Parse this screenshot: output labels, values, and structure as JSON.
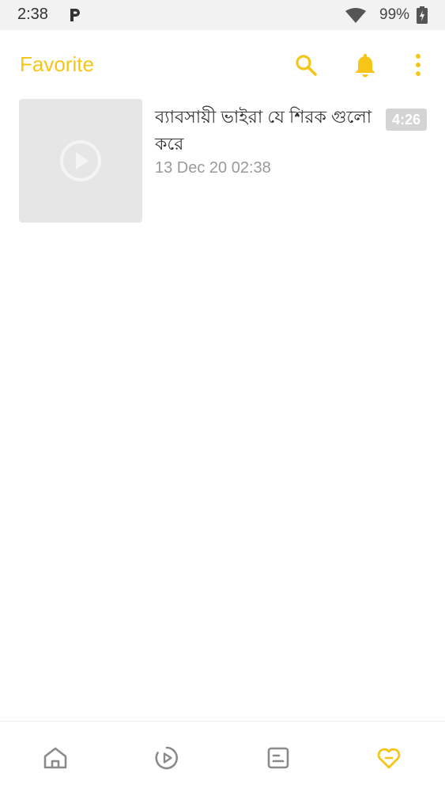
{
  "status_bar": {
    "time": "2:38",
    "battery_percent": "99%",
    "icons": [
      "p-notification-icon",
      "wifi-icon",
      "battery-charging-icon"
    ]
  },
  "app_bar": {
    "title": "Favorite",
    "actions": [
      "search-icon",
      "bell-icon",
      "more-vert-icon"
    ]
  },
  "favorites": [
    {
      "title": "ব্যাবসায়ী ভাইরা যে শিরক গুলো করে",
      "date": "13 Dec 20 02:38",
      "duration": "4:26"
    }
  ],
  "bottom_nav": {
    "items": [
      "home-icon",
      "play-circle-icon",
      "list-icon",
      "favorite-heart-icon"
    ],
    "active": "favorite-heart-icon"
  },
  "colors": {
    "accent": "#f5c518",
    "inactive_icon": "#8a8a8a",
    "thumbnail_bg": "#e6e6e6",
    "badge_bg": "#d4d4d4"
  }
}
